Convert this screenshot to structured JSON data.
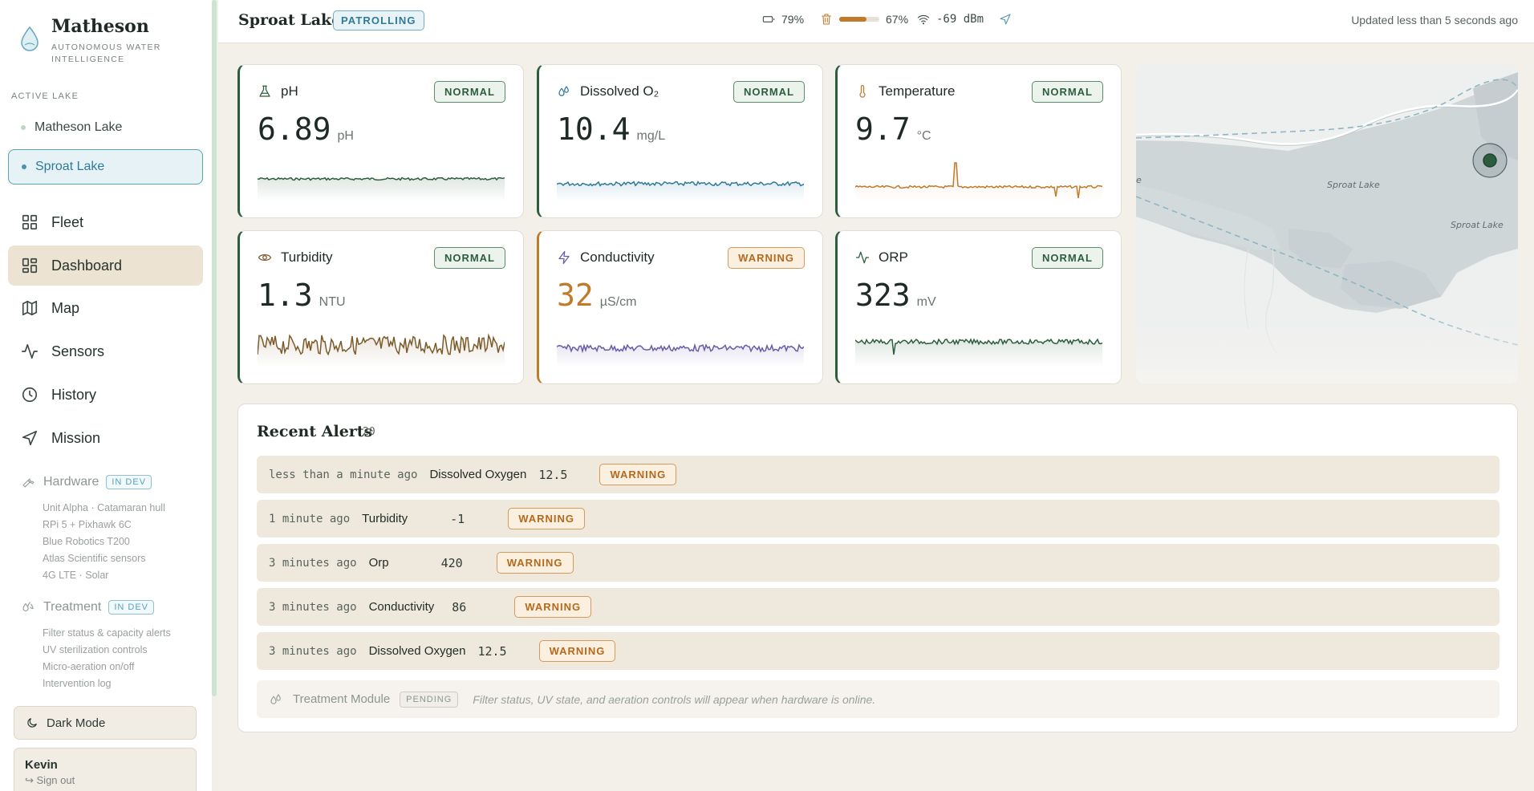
{
  "brand": {
    "name": "Matheson",
    "tagline": "AUTONOMOUS WATER INTELLIGENCE"
  },
  "sidebar": {
    "active_lake_label": "ACTIVE LAKE",
    "lakes": [
      {
        "label": "Matheson Lake",
        "active": false
      },
      {
        "label": "Sproat Lake",
        "active": true
      }
    ],
    "nav": [
      {
        "label": "Fleet",
        "icon": "grid-icon"
      },
      {
        "label": "Dashboard",
        "icon": "dashboard-icon",
        "active": true
      },
      {
        "label": "Map",
        "icon": "map-icon"
      },
      {
        "label": "Sensors",
        "icon": "activity-icon"
      },
      {
        "label": "History",
        "icon": "clock-icon"
      },
      {
        "label": "Mission",
        "icon": "navigation-icon"
      }
    ],
    "hardware": {
      "label": "Hardware",
      "badge": "IN DEV",
      "items": [
        "Unit Alpha · Catamaran hull",
        "RPi 5 + Pixhawk 6C",
        "Blue Robotics T200",
        "Atlas Scientific sensors",
        "4G LTE · Solar"
      ]
    },
    "treatment": {
      "label": "Treatment",
      "badge": "IN DEV",
      "items": [
        "Filter status & capacity alerts",
        "UV sterilization controls",
        "Micro-aeration on/off",
        "Intervention log"
      ]
    },
    "dark_mode_label": "Dark Mode",
    "user": {
      "name": "Kevin",
      "signout": "↪ Sign out"
    }
  },
  "topbar": {
    "lake_name": "Sproat Lake",
    "status": "PATROLLING",
    "battery": "79%",
    "tank": {
      "label": "67%",
      "level": 0.67
    },
    "signal": "-69 dBm",
    "updated": "Updated less than 5 seconds ago"
  },
  "metrics": [
    {
      "name": "pH",
      "value": "6.89",
      "unit": "pH",
      "status": "NORMAL",
      "color": "#2c5e3e"
    },
    {
      "name": "Dissolved O₂",
      "value": "10.4",
      "unit": "mg/L",
      "status": "NORMAL",
      "color": "#2f7a99"
    },
    {
      "name": "Temperature",
      "value": "9.7",
      "unit": "°C",
      "status": "NORMAL",
      "color": "#c07a2a"
    },
    {
      "name": "Turbidity",
      "value": "1.3",
      "unit": "NTU",
      "status": "NORMAL",
      "color": "#7c5a2a"
    },
    {
      "name": "Conductivity",
      "value": "32",
      "unit": "µS/cm",
      "status": "WARNING",
      "color": "#6b5aa8"
    },
    {
      "name": "ORP",
      "value": "323",
      "unit": "mV",
      "status": "NORMAL",
      "color": "#2c5e3e"
    }
  ],
  "map": {
    "labels": [
      "Sproat Lake",
      "Sproat Lake",
      "e"
    ]
  },
  "alerts": {
    "title": "Recent Alerts",
    "count": "20",
    "rows": [
      {
        "time": "less than a minute ago",
        "metric": "Dissolved Oxygen",
        "value": "12.5",
        "status": "WARNING"
      },
      {
        "time": "1 minute ago",
        "metric": "Turbidity",
        "value": "-1",
        "status": "WARNING"
      },
      {
        "time": "3 minutes ago",
        "metric": "Orp",
        "value": "420",
        "status": "WARNING"
      },
      {
        "time": "3 minutes ago",
        "metric": "Conductivity",
        "value": "86",
        "status": "WARNING"
      },
      {
        "time": "3 minutes ago",
        "metric": "Dissolved Oxygen",
        "value": "12.5",
        "status": "WARNING"
      }
    ],
    "treatment": {
      "name": "Treatment Module",
      "badge": "PENDING",
      "desc": "Filter status, UV state, and aeration controls will appear when hardware is online."
    }
  }
}
